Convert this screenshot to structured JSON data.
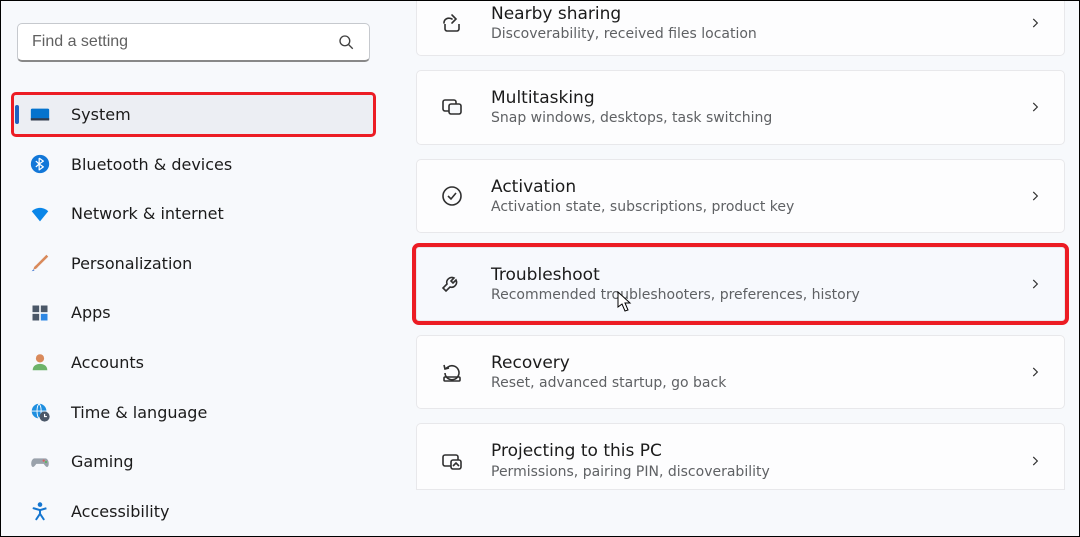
{
  "search": {
    "placeholder": "Find a setting"
  },
  "nav": [
    {
      "label": "System"
    },
    {
      "label": "Bluetooth & devices"
    },
    {
      "label": "Network & internet"
    },
    {
      "label": "Personalization"
    },
    {
      "label": "Apps"
    },
    {
      "label": "Accounts"
    },
    {
      "label": "Time & language"
    },
    {
      "label": "Gaming"
    },
    {
      "label": "Accessibility"
    }
  ],
  "cards": [
    {
      "title": "Nearby sharing",
      "desc": "Discoverability, received files location"
    },
    {
      "title": "Multitasking",
      "desc": "Snap windows, desktops, task switching"
    },
    {
      "title": "Activation",
      "desc": "Activation state, subscriptions, product key"
    },
    {
      "title": "Troubleshoot",
      "desc": "Recommended troubleshooters, preferences, history"
    },
    {
      "title": "Recovery",
      "desc": "Reset, advanced startup, go back"
    },
    {
      "title": "Projecting to this PC",
      "desc": "Permissions, pairing PIN, discoverability"
    }
  ]
}
